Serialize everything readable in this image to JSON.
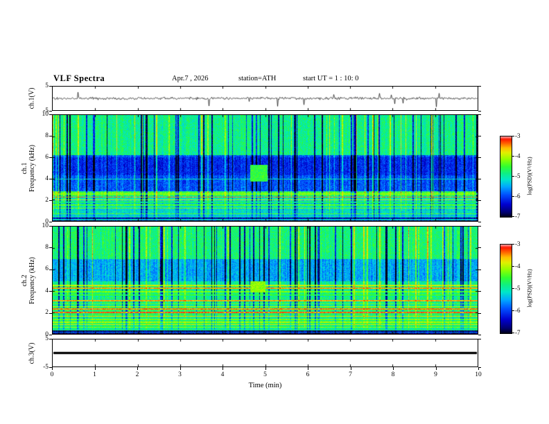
{
  "figure": {
    "title": "VLF Spectra",
    "header": {
      "date": "Apr.7 , 2026",
      "station": "station=ATH",
      "start_ut": "start UT =  1 : 10: 0"
    },
    "xaxis": {
      "label": "Time (min)",
      "min": 0,
      "max": 10,
      "ticks": [
        0,
        1,
        2,
        3,
        4,
        5,
        6,
        7,
        8,
        9,
        10
      ]
    },
    "colorbar": {
      "label": "log(PSD)(V²/Hz)",
      "min": -7,
      "max": -3,
      "ticks": [
        -3,
        -4,
        -5,
        -6,
        -7
      ]
    },
    "colormap": [
      {
        "t": 0.0,
        "c": "#000010"
      },
      {
        "t": 0.06,
        "c": "#000070"
      },
      {
        "t": 0.16,
        "c": "#0000d0"
      },
      {
        "t": 0.28,
        "c": "#0050ff"
      },
      {
        "t": 0.38,
        "c": "#00a8ff"
      },
      {
        "t": 0.47,
        "c": "#00e8c8"
      },
      {
        "t": 0.55,
        "c": "#10f080"
      },
      {
        "t": 0.63,
        "c": "#30ff30"
      },
      {
        "t": 0.72,
        "c": "#90ff00"
      },
      {
        "t": 0.8,
        "c": "#e0f000"
      },
      {
        "t": 0.86,
        "c": "#ffc000"
      },
      {
        "t": 0.92,
        "c": "#ff6000"
      },
      {
        "t": 0.97,
        "c": "#ff1800"
      },
      {
        "t": 1.0,
        "c": "#ff9898"
      }
    ]
  },
  "chart_data": [
    {
      "type": "line",
      "panel": "ch1-waveform",
      "ylabel": "ch.1(V)",
      "ylim": [
        -5,
        5
      ],
      "yticks": [
        5,
        -5
      ],
      "signal": {
        "kind": "noisy",
        "mean": 0,
        "noise_amp": 0.55,
        "spike_down_prob": 0.02,
        "spike_down_amp": 3.8,
        "spike_up_prob": 0.012,
        "spike_up_amp": 2.2
      },
      "line_color": "#000000"
    },
    {
      "type": "heatmap",
      "panel": "ch1-spectrogram",
      "ylabel_channel": "ch.1",
      "ylabel": "Frequency (kHz)",
      "ylim": [
        0,
        10
      ],
      "yticks": [
        0,
        2,
        4,
        6,
        8,
        10
      ],
      "xlim": [
        0,
        10
      ],
      "value_range": [
        -7,
        -3
      ],
      "base": 0.54,
      "bands": [
        {
          "f": [
            2.8,
            6.2
          ],
          "bias": -0.26
        },
        {
          "f": [
            4.3,
            6.0
          ],
          "bias": -0.06
        },
        {
          "f": [
            2.35,
            2.8
          ],
          "bias": 0.08
        },
        {
          "f": [
            0.35,
            2.35
          ],
          "bias": -0.08
        },
        {
          "f": [
            0.0,
            0.35
          ],
          "bias": -0.47
        }
      ],
      "lines": [
        {
          "f": 4.6,
          "h": 0.05,
          "t": 0.22
        },
        {
          "f": 3.95,
          "h": 0.06,
          "t": 0.5
        },
        {
          "f": 2.55,
          "h": 0.07,
          "t": 0.72
        },
        {
          "f": 2.25,
          "h": 0.05,
          "t": 0.9,
          "gap": true
        },
        {
          "f": 2.0,
          "h": 0.04,
          "t": 0.78
        },
        {
          "f": 1.75,
          "h": 0.05,
          "t": 0.58
        },
        {
          "f": 1.5,
          "h": 0.05,
          "t": 0.66
        },
        {
          "f": 1.2,
          "h": 0.05,
          "t": 0.7
        },
        {
          "f": 0.95,
          "h": 0.04,
          "t": 0.52
        },
        {
          "f": 0.7,
          "h": 0.04,
          "t": 0.66
        },
        {
          "f": 0.5,
          "h": 0.04,
          "t": 0.38
        },
        {
          "f": 0.15,
          "h": 0.06,
          "t": 0.45
        }
      ],
      "blob": {
        "x": [
          4.65,
          5.05
        ],
        "f": [
          3.7,
          5.3
        ],
        "t": 0.62
      },
      "streaks": {
        "dark_prob": 0.1,
        "bright_prob": 0.05
      },
      "row_band_max": 2.8,
      "streak_fade": 2.5,
      "pixel_noise": 0.16
    },
    {
      "type": "heatmap",
      "panel": "ch2-spectrogram",
      "ylabel_channel": "ch.2",
      "ylabel": "Frequency (kHz)",
      "ylim": [
        0,
        10
      ],
      "yticks": [
        0,
        2,
        4,
        6,
        8,
        10
      ],
      "xlim": [
        0,
        10
      ],
      "value_range": [
        -7,
        -3
      ],
      "base": 0.56,
      "bands": [
        {
          "f": [
            4.9,
            7.0
          ],
          "bias": -0.18
        },
        {
          "f": [
            0.3,
            4.9
          ],
          "bias": -0.02
        },
        {
          "f": [
            0.0,
            0.3
          ],
          "bias": -0.5
        }
      ],
      "lines": [
        {
          "f": 4.5,
          "h": 0.06,
          "t": 0.78
        },
        {
          "f": 4.25,
          "h": 0.05,
          "t": 0.88
        },
        {
          "f": 3.95,
          "h": 0.05,
          "t": 0.7
        },
        {
          "f": 3.6,
          "h": 0.05,
          "t": 0.62
        },
        {
          "f": 3.1,
          "h": 0.07,
          "t": 0.87
        },
        {
          "f": 2.8,
          "h": 0.04,
          "t": 0.7
        },
        {
          "f": 2.55,
          "h": 0.05,
          "t": 0.78
        },
        {
          "f": 2.3,
          "h": 0.06,
          "t": 0.9
        },
        {
          "f": 2.0,
          "h": 0.08,
          "t": 0.93
        },
        {
          "f": 1.65,
          "h": 0.05,
          "t": 0.82
        },
        {
          "f": 1.35,
          "h": 0.05,
          "t": 0.7
        },
        {
          "f": 1.1,
          "h": 0.04,
          "t": 0.74
        },
        {
          "f": 0.85,
          "h": 0.04,
          "t": 0.8
        },
        {
          "f": 0.6,
          "h": 0.04,
          "t": 0.72
        },
        {
          "f": 0.38,
          "h": 0.04,
          "t": 0.55
        },
        {
          "f": 0.15,
          "h": 0.05,
          "t": 0.35
        }
      ],
      "blob": {
        "x": [
          4.65,
          5.0
        ],
        "f": [
          3.9,
          4.9
        ],
        "t": 0.72
      },
      "streaks": {
        "dark_prob": 0.1,
        "bright_prob": 0.05
      },
      "row_band_max": 4.9,
      "streak_fade": 4.5,
      "pixel_noise": 0.16
    },
    {
      "type": "line",
      "panel": "ch3-waveform",
      "ylabel": "ch.3(V)",
      "ylim": [
        -5,
        5
      ],
      "yticks": [
        5,
        -5
      ],
      "signal": {
        "kind": "flat",
        "value": 0,
        "thickness_v": 0.5
      },
      "line_color": "#000000"
    }
  ]
}
